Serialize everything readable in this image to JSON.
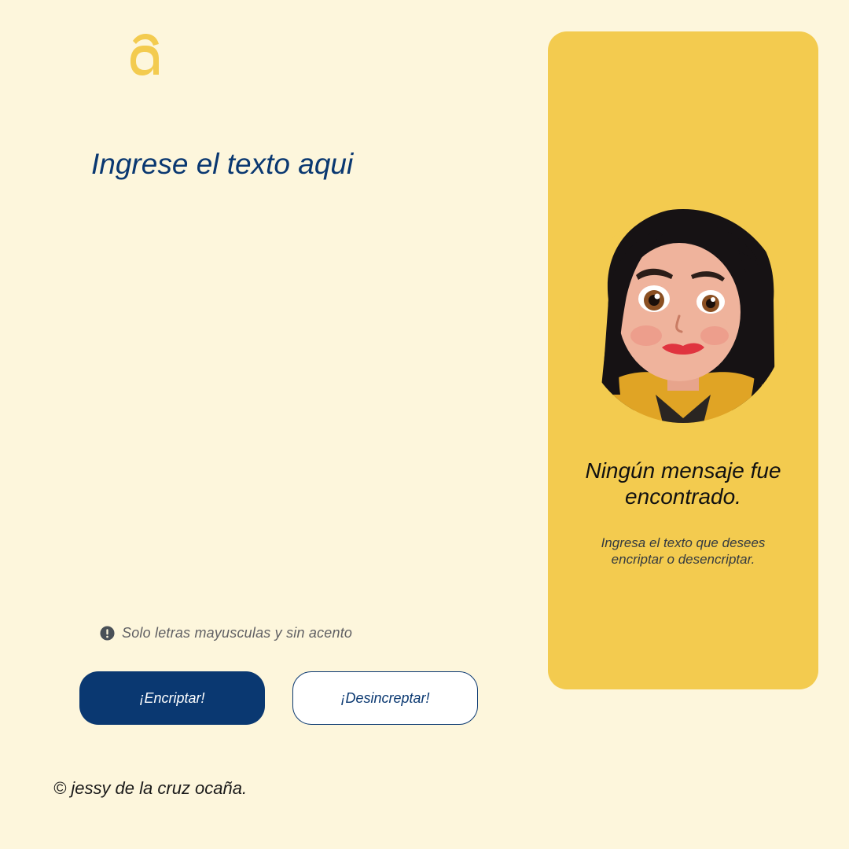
{
  "brand": {
    "accent_color": "#f3cb4f",
    "primary_color": "#0a3871",
    "background_color": "#fdf6dc",
    "logo_icon": "letter-a-logo"
  },
  "input": {
    "placeholder": "Ingrese el texto aqui",
    "value": ""
  },
  "hint": {
    "icon": "exclamation-circle-icon",
    "text": "Solo letras mayusculas y sin acento"
  },
  "buttons": {
    "encrypt_label": "¡Encriptar!",
    "decrypt_label": "¡Desincreptar!"
  },
  "output": {
    "avatar": "girl-avatar-illustration",
    "empty_title": "Ningún mensaje fue encontrado.",
    "empty_subtitle": "Ingresa el texto que desees encriptar o desencriptar."
  },
  "footer": {
    "text": "© jessy de la cruz ocaña."
  }
}
